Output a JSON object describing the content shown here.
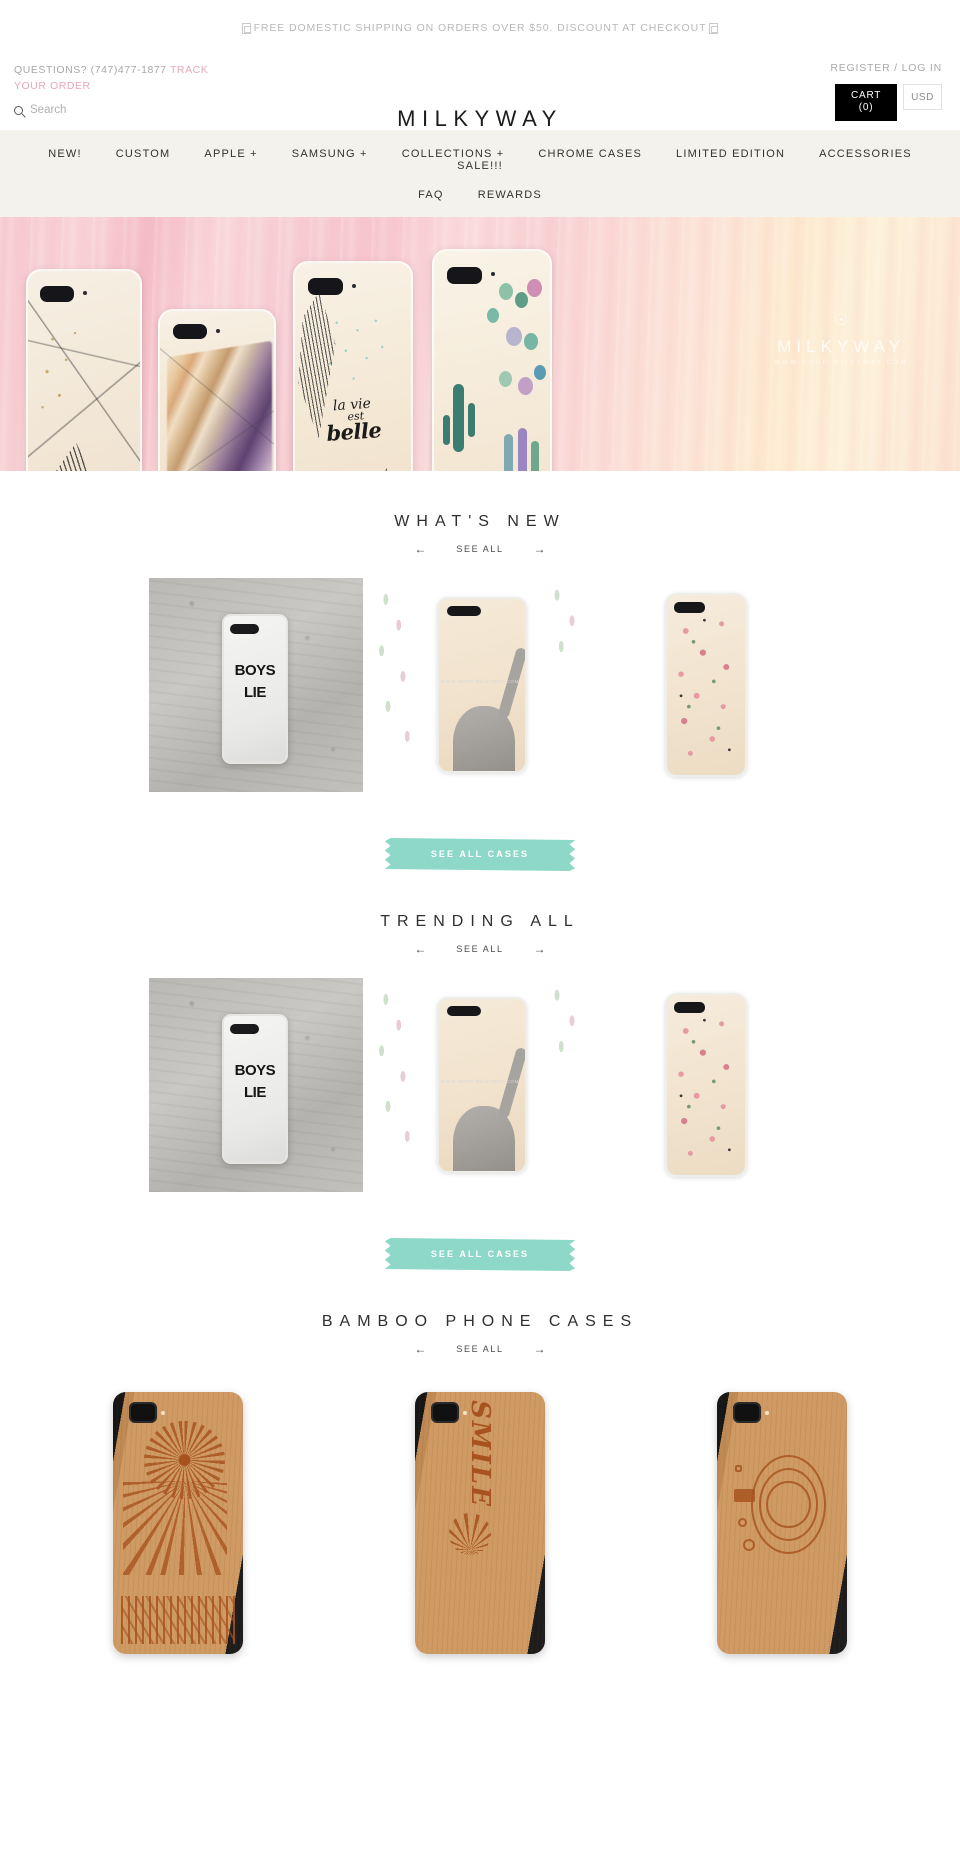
{
  "announcement": {
    "text": "FREE DOMESTIC SHIPPING  ON ORDERS OVER $50. DISCOUNT AT CHECKOUT",
    "prefix_emoji": "emoji-box",
    "suffix_emoji": "emoji-box"
  },
  "header": {
    "questions_label": "QUESTIONS? (747)477-1877 ",
    "track_order_label": "TRACK YOUR ORDER",
    "search_placeholder": "Search",
    "logo": "MILKYWAY",
    "register_login": "REGISTER / LOG IN",
    "cart_label": "CART",
    "cart_count": "(0)",
    "currency": "USD",
    "colors": {
      "track_link": "#e8a9b5",
      "cart_bg": "#000000",
      "nav_bg": "#f3f2ec"
    }
  },
  "nav": {
    "row1": [
      {
        "label": "NEW!"
      },
      {
        "label": "CUSTOM"
      },
      {
        "label": "APPLE +"
      },
      {
        "label": "SAMSUNG +"
      },
      {
        "label": "COLLECTIONS +"
      },
      {
        "label": "CHROME CASES"
      },
      {
        "label": "LIMITED EDITION"
      },
      {
        "label": "ACCESSORIES"
      },
      {
        "label": "SALE!!!"
      }
    ],
    "row2": [
      {
        "label": "FAQ"
      },
      {
        "label": "REWARDS"
      }
    ]
  },
  "hero": {
    "phone3_line1": "la vie",
    "phone3_line2": "est",
    "phone3_line3": "belle",
    "watermark_logo": "MILKYWAY",
    "watermark_sub": "WWW.SHOP-MILKYWAY.COM",
    "watermark_icon": "planet-icon"
  },
  "sections": [
    {
      "title": "WHAT'S NEW",
      "prev_label": "←",
      "see_all_label": "SEE ALL",
      "next_label": "→",
      "button_label": "SEE ALL CASES",
      "button_color": "#8ed8c7",
      "products": [
        {
          "name": "boys-lie-case",
          "line1": "BOYS",
          "line2": "LIE"
        },
        {
          "name": "elephant-floral-case",
          "watermark": "WWW.SHOP-MILKYWAY.COM"
        },
        {
          "name": "rose-pattern-case",
          "watermark": ""
        }
      ]
    },
    {
      "title": "TRENDING ALL",
      "prev_label": "←",
      "see_all_label": "SEE ALL",
      "next_label": "→",
      "button_label": "SEE ALL CASES",
      "button_color": "#8ed8c7",
      "products": [
        {
          "name": "boys-lie-case",
          "line1": "BOYS",
          "line2": "LIE"
        },
        {
          "name": "elephant-floral-case",
          "watermark": "WWW.SHOP-MILKYWAY.COM"
        },
        {
          "name": "rose-pattern-case",
          "watermark": ""
        }
      ]
    },
    {
      "title": "BAMBOO PHONE CASES",
      "prev_label": "←",
      "see_all_label": "SEE ALL",
      "next_label": "→",
      "products": [
        {
          "name": "bamboo-mandala-sun-case"
        },
        {
          "name": "bamboo-smile-palm-case",
          "text": "SMILE"
        },
        {
          "name": "bamboo-camera-case"
        }
      ]
    }
  ]
}
